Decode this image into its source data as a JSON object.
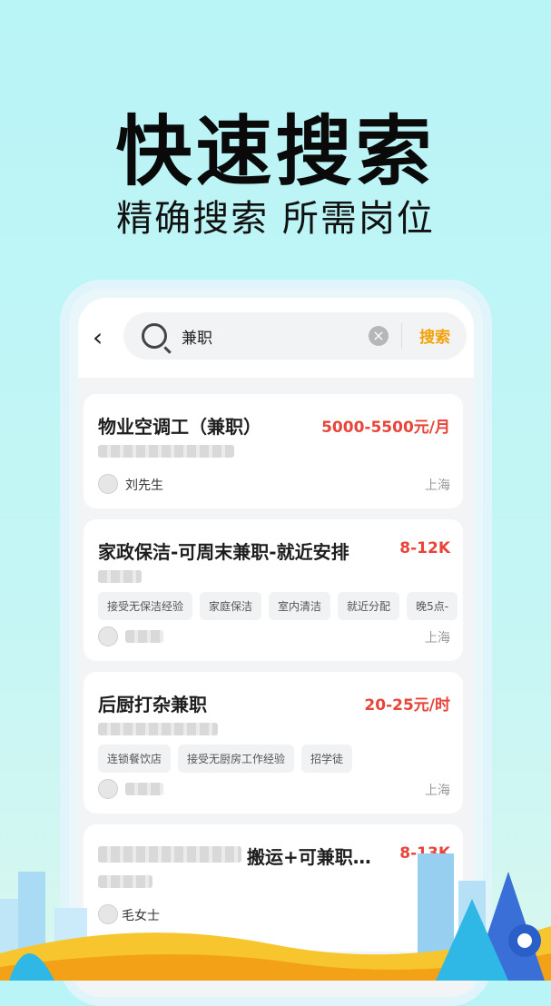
{
  "hero": {
    "title": "快速搜索",
    "subtitle": "精确搜索 所需岗位"
  },
  "search": {
    "back_icon": "chevron-left-icon",
    "query": "兼职",
    "clear_icon": "clear-icon",
    "button_label": "搜索"
  },
  "jobs": [
    {
      "title": "物业空调工（兼职）",
      "salary": "5000-5500元/月",
      "person": "刘先生",
      "location": "上海",
      "tags": []
    },
    {
      "title": "家政保洁-可周末兼职-就近安排",
      "salary": "8-12K",
      "person": "",
      "location": "上海",
      "tags": [
        "接受无保洁经验",
        "家庭保洁",
        "室内清洁",
        "就近分配",
        "晚5点-"
      ]
    },
    {
      "title": "后厨打杂兼职",
      "salary": "20-25元/时",
      "person": "",
      "location": "上海",
      "tags": [
        "连锁餐饮店",
        "接受无厨房工作经验",
        "招学徒"
      ]
    },
    {
      "title": "搬运+可兼职…",
      "salary": "8-13K",
      "person": "毛女士",
      "location": "",
      "tags": []
    }
  ],
  "colors": {
    "accent": "#f2a20a",
    "salary": "#e8443a",
    "bg": "#b9f4f6"
  }
}
